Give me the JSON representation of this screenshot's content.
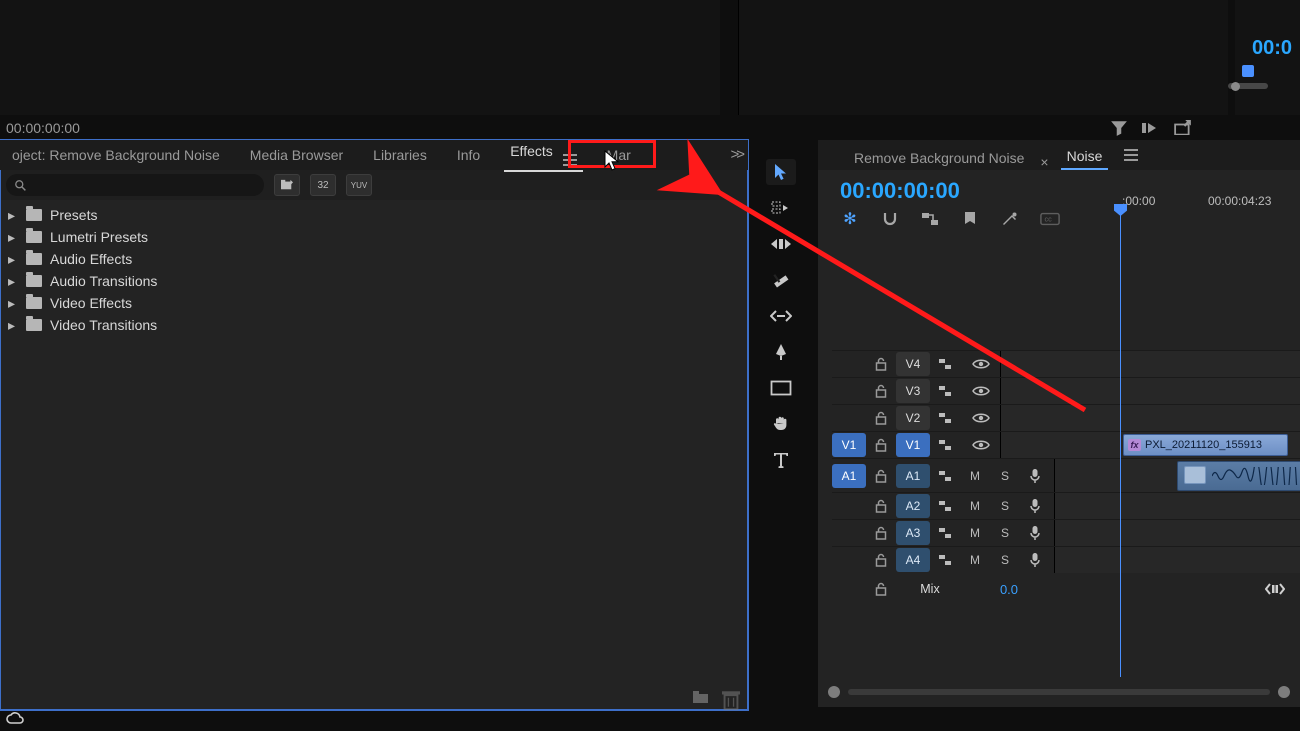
{
  "source": {
    "timecode": "00:00:00:00"
  },
  "program": {
    "timecode_fragment": "00:0"
  },
  "panel_tabs": {
    "project": "oject: Remove Background Noise",
    "media_browser": "Media Browser",
    "libraries": "Libraries",
    "info": "Info",
    "effects": "Effects",
    "markers_fragment": "Mar",
    "overflow": ">>"
  },
  "search_icons": {
    "b1": "⎘",
    "b2": "32",
    "b3": "YUV"
  },
  "effects_tree": [
    "Presets",
    "Lumetri Presets",
    "Audio Effects",
    "Audio Transitions",
    "Video Effects",
    "Video Transitions"
  ],
  "timeline": {
    "sequence_name": "Remove Background Noise",
    "active_tab": "Noise",
    "timecode": "00:00:00:00",
    "ruler": {
      "t0": ":00:00",
      "t1": "00:00:04:23"
    },
    "tracks": {
      "video": [
        "V4",
        "V3",
        "V2",
        "V1"
      ],
      "audio": [
        "A1",
        "A2",
        "A3",
        "A4"
      ],
      "src_v": "V1",
      "src_a": "A1"
    },
    "clip_name": "PXL_20211120_155913",
    "fx_badge": "fx",
    "mix": {
      "label": "Mix",
      "value": "0.0"
    },
    "btn": {
      "mute": "M",
      "solo": "S"
    }
  }
}
